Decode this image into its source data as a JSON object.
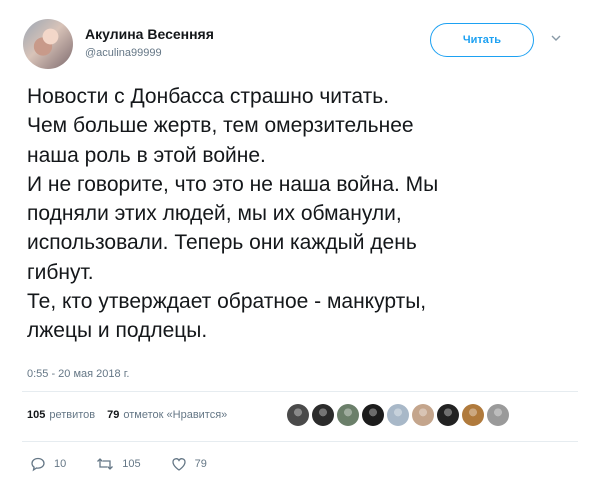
{
  "author": {
    "name": "Акулина Весенняя",
    "handle": "@aculina99999"
  },
  "follow_label": "Читать",
  "tweet_lines": [
    "Новости с Донбасса страшно читать.",
    "Чем больше жертв, тем омерзительнее",
    "наша роль в этой войне.",
    "И не говорите, что это не наша война. Мы",
    "подняли этих людей, мы их обманули,",
    "использовали. Теперь они каждый день",
    "гибнут.",
    "Те, кто утверждает обратное - манкурты,",
    "лжецы и подлецы."
  ],
  "timestamp": "0:55 - 20 мая 2018 г.",
  "stats": {
    "retweets_count": "105",
    "retweets_label": "ретвитов",
    "likes_count": "79",
    "likes_label": "отметок «Нравится»"
  },
  "liker_avatars": [
    {
      "icon": "liker-avatar-icon",
      "color": "#4a4a4a"
    },
    {
      "icon": "liker-avatar-icon",
      "color": "#2b2b2b"
    },
    {
      "icon": "liker-avatar-icon",
      "color": "#6b7f6a"
    },
    {
      "icon": "liker-avatar-icon",
      "color": "#1c1c1c"
    },
    {
      "icon": "liker-avatar-icon",
      "color": "#a8b8c8"
    },
    {
      "icon": "liker-avatar-icon",
      "color": "#c4a58c"
    },
    {
      "icon": "liker-avatar-icon",
      "color": "#222222"
    },
    {
      "icon": "liker-avatar-icon",
      "color": "#b07a3c"
    },
    {
      "icon": "liker-avatar-icon",
      "color": "#9a9a9a"
    }
  ],
  "actions": {
    "reply_count": "10",
    "retweet_count": "105",
    "like_count": "79"
  },
  "colors": {
    "accent": "#1da1f2",
    "secondary_text": "#657786",
    "primary_text": "#14171a",
    "divider": "#e6ecf0"
  }
}
